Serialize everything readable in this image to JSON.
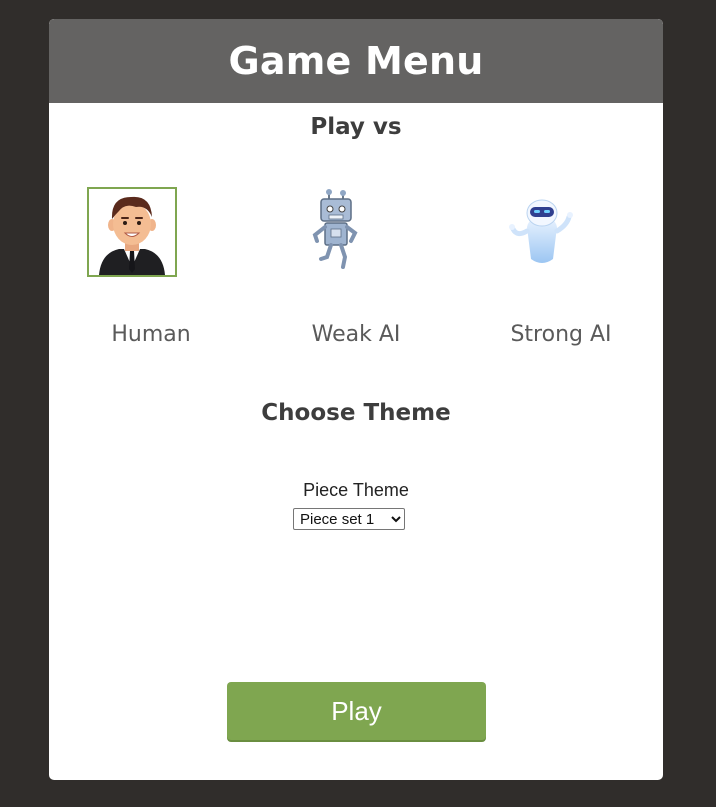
{
  "menu": {
    "title": "Game Menu",
    "play_vs_heading": "Play vs",
    "opponents": [
      {
        "label": "Human",
        "icon": "human-avatar-icon",
        "selected": true
      },
      {
        "label": "Weak AI",
        "icon": "weak-robot-icon",
        "selected": false
      },
      {
        "label": "Strong AI",
        "icon": "strong-robot-icon",
        "selected": false
      }
    ],
    "theme_heading": "Choose Theme",
    "piece_theme_label": "Piece Theme",
    "piece_theme_selected": "Piece set 1",
    "play_button": "Play"
  },
  "colors": {
    "background": "#302d2b",
    "header": "#646362",
    "accent": "#7fa650",
    "panel": "#ffffff"
  }
}
